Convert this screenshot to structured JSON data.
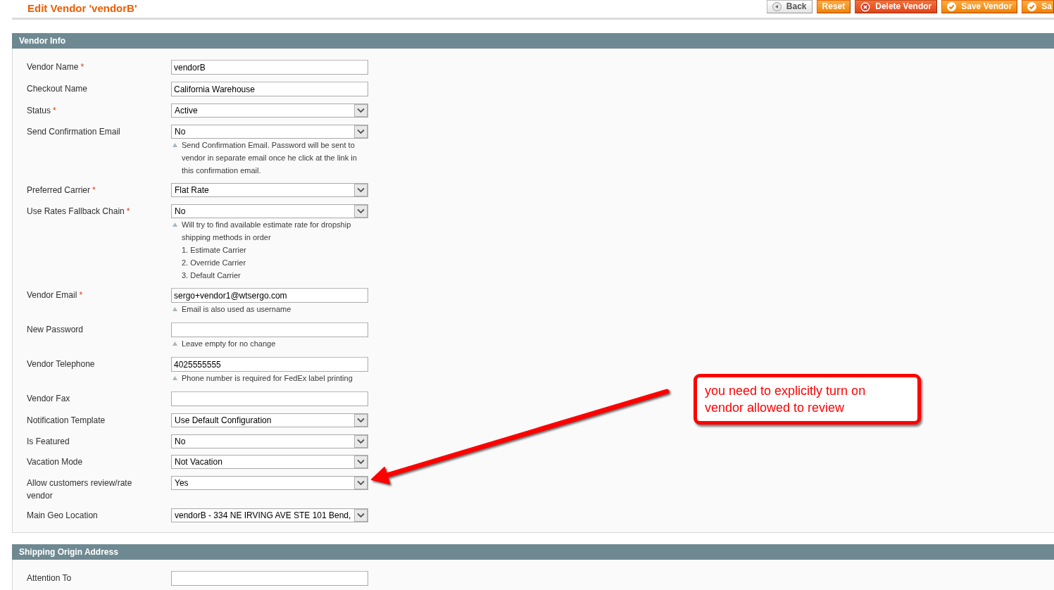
{
  "page_title": "Edit Vendor 'vendorB'",
  "buttons": [
    {
      "label": "Back",
      "kind": "back"
    },
    {
      "label": "Reset",
      "kind": "plain"
    },
    {
      "label": "Delete Vendor",
      "kind": "delete"
    },
    {
      "label": "Save Vendor",
      "kind": "save"
    },
    {
      "label": "Sa",
      "kind": "save"
    }
  ],
  "sections": [
    {
      "title": "Vendor Info",
      "fields": [
        {
          "label": "Vendor Name",
          "required_mark": "*",
          "kind": "text",
          "value": "vendorB"
        },
        {
          "label": "Checkout Name",
          "kind": "text",
          "value": "California Warehouse"
        },
        {
          "label": "Status",
          "required_mark": "*",
          "kind": "select",
          "value": "Active"
        },
        {
          "label": "Send Confirmation Email",
          "kind": "select",
          "value": "No",
          "note": [
            "Send Confirmation Email. Password will be sent to vendor in separate email once he click at the link in this confirmation email."
          ]
        },
        {
          "label": "Preferred Carrier",
          "required_mark": "*",
          "kind": "select",
          "value": "Flat Rate"
        },
        {
          "label": "Use Rates Fallback Chain",
          "required_mark": "*",
          "kind": "select",
          "value": "No",
          "note": [
            "Will try to find available estimate rate for dropship shipping methods in order",
            "1. Estimate Carrier",
            "2. Override Carrier",
            "3. Default Carrier"
          ]
        },
        {
          "label": "Vendor Email",
          "required_mark": "*",
          "kind": "text",
          "value": "sergo+vendor1@wtsergo.com",
          "note": [
            "Email is also used as username"
          ]
        },
        {
          "label": "New Password",
          "kind": "text",
          "note": [
            "Leave empty for no change"
          ]
        },
        {
          "label": "Vendor Telephone",
          "kind": "text",
          "value": "4025555555",
          "note": [
            "Phone number is required for FedEx label printing"
          ]
        },
        {
          "label": "Vendor Fax",
          "kind": "text"
        },
        {
          "label": "Notification Template",
          "kind": "select",
          "value": "Use Default Configuration"
        },
        {
          "label": "Is Featured",
          "kind": "select",
          "value": "No"
        },
        {
          "label": "Vacation Mode",
          "kind": "select",
          "value": "Not Vacation"
        },
        {
          "label": "Allow customers review/rate vendor",
          "kind": "select",
          "value": "Yes"
        },
        {
          "label": "Main Geo Location",
          "kind": "select",
          "value": "vendorB - 334 NE IRVING AVE STE 101 Bend,"
        }
      ]
    },
    {
      "title": "Shipping Origin Address",
      "fields": [
        {
          "label": "Attention To",
          "kind": "text"
        }
      ]
    }
  ],
  "annotation": {
    "text": "you need to explicitly turn on vendor allowed to review"
  }
}
